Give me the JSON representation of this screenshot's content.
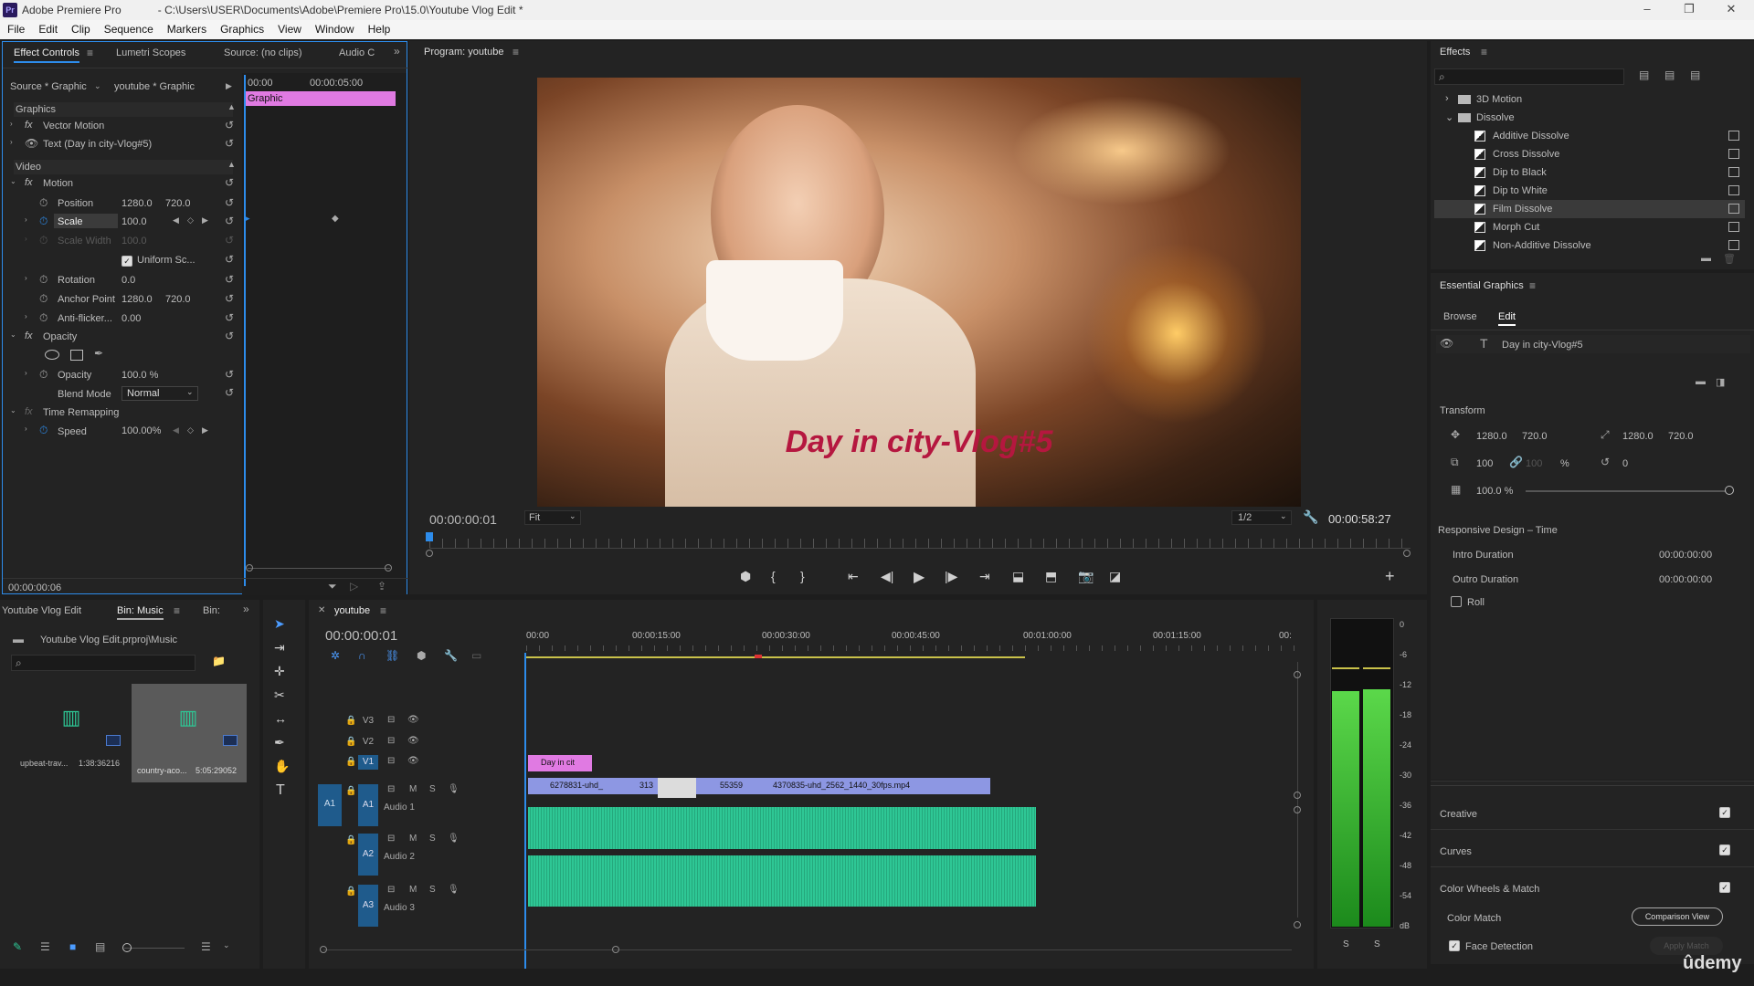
{
  "window": {
    "app_title": "Adobe Premiere Pro",
    "path_title": "C:\\Users\\USER\\Documents\\Adobe\\Premiere Pro\\15.0\\Youtube Vlog Edit *",
    "logo": "Pr",
    "min": "–",
    "max": "❐",
    "close": "✕"
  },
  "menu": [
    "File",
    "Edit",
    "Clip",
    "Sequence",
    "Markers",
    "Graphics",
    "View",
    "Window",
    "Help"
  ],
  "effect_controls": {
    "tabs": [
      "Effect Controls",
      "Lumetri Scopes",
      "Source: (no clips)",
      "Audio C"
    ],
    "source_label": "Source * Graphic",
    "sequence_label": "youtube * Graphic",
    "ruler": [
      "00:00",
      "00:00:05:00"
    ],
    "clip_label": "Graphic",
    "sections": {
      "graphics": "Graphics",
      "video": "Video"
    },
    "vector_motion": "Vector Motion",
    "text_layer": "Text (Day in city-Vlog#5)",
    "motion": "Motion",
    "position": "Position",
    "pos_x": "1280.0",
    "pos_y": "720.0",
    "scale": "Scale",
    "scale_val": "100.0",
    "scale_width": "Scale Width",
    "scale_width_val": "100.0",
    "uniform": "Uniform Sc...",
    "rotation": "Rotation",
    "rotation_val": "0.0",
    "anchor": "Anchor Point",
    "anchor_x": "1280.0",
    "anchor_y": "720.0",
    "antiflicker": "Anti-flicker...",
    "antiflicker_val": "0.00",
    "opacity_fx": "Opacity",
    "opacity": "Opacity",
    "opacity_val": "100.0 %",
    "blend": "Blend Mode",
    "blend_val": "Normal",
    "time_remap": "Time Remapping",
    "speed": "Speed",
    "speed_val": "100.00%",
    "timecode": "00:00:00:06"
  },
  "program": {
    "title": "Program: youtube",
    "overlay_text": "Day in city-Vlog#5",
    "timecode": "00:00:00:01",
    "fit": "Fit",
    "res": "1/2",
    "duration": "00:00:58:27"
  },
  "effects_panel": {
    "title": "Effects",
    "items": [
      {
        "label": "3D Motion",
        "kind": "folder"
      },
      {
        "label": "Dissolve",
        "kind": "folder-open"
      },
      {
        "label": "Additive Dissolve",
        "kind": "fx"
      },
      {
        "label": "Cross Dissolve",
        "kind": "fx"
      },
      {
        "label": "Dip to Black",
        "kind": "fx"
      },
      {
        "label": "Dip to White",
        "kind": "fx"
      },
      {
        "label": "Film Dissolve",
        "kind": "fx"
      },
      {
        "label": "Morph Cut",
        "kind": "fx"
      },
      {
        "label": "Non-Additive Dissolve",
        "kind": "fx"
      }
    ]
  },
  "essential_graphics": {
    "title": "Essential Graphics",
    "tabs": [
      "Browse",
      "Edit"
    ],
    "layer": "Day in city-Vlog#5",
    "transform": "Transform",
    "pos_x": "1280.0",
    "pos_y": "720.0",
    "anchor_x": "1280.0",
    "anchor_y": "720.0",
    "scale": "100",
    "scale2": "100",
    "pct": "%",
    "rotation": "0",
    "opacity": "100.0 %",
    "responsive": "Responsive Design – Time",
    "intro": "Intro Duration",
    "intro_val": "00:00:00:00",
    "outro": "Outro Duration",
    "outro_val": "00:00:00:00",
    "roll": "Roll"
  },
  "lumetri": {
    "creative": "Creative",
    "curves": "Curves",
    "wheels": "Color Wheels & Match",
    "color_match": "Color Match",
    "comparison": "Comparison View",
    "face": "Face Detection",
    "apply": "Apply Match"
  },
  "project": {
    "tabs": [
      "Youtube Vlog Edit",
      "Bin: Music",
      "Bin:"
    ],
    "path": "Youtube Vlog Edit.prproj\\Music",
    "items": [
      {
        "name": "upbeat-trav...",
        "dur": "1:38:36216"
      },
      {
        "name": "country-aco...",
        "dur": "5:05:29052"
      }
    ]
  },
  "timeline": {
    "tab": "youtube",
    "timecode": "00:00:00:01",
    "ruler": [
      "00:00",
      "00:00:15:00",
      "00:00:30:00",
      "00:00:45:00",
      "00:01:00:00",
      "00:01:15:00",
      "00:"
    ],
    "tracks": [
      {
        "id": "V3"
      },
      {
        "id": "V2"
      },
      {
        "id": "V1"
      },
      {
        "id": "A1",
        "name": "Audio 1"
      },
      {
        "id": "A2",
        "name": "Audio 2"
      },
      {
        "id": "A3",
        "name": "Audio 3"
      }
    ],
    "clips": {
      "v2": "Day in cit",
      "v1a": "6278831-uhd_",
      "v1b": "313",
      "v1c": "55359",
      "v1d": "4370835-uhd_2562_1440_30fps.mp4"
    }
  },
  "meter": {
    "scale": [
      "0",
      "-6",
      "-12",
      "-18",
      "-24",
      "-30",
      "-36",
      "-42",
      "-48",
      "-54",
      "dB"
    ],
    "s1": "S",
    "s2": "S"
  },
  "watermark": "ûdemy",
  "colors": {
    "accent": "#4c9cff",
    "audio": "#2ec795",
    "video": "#8d97e3",
    "graphic": "#e07ae2"
  }
}
